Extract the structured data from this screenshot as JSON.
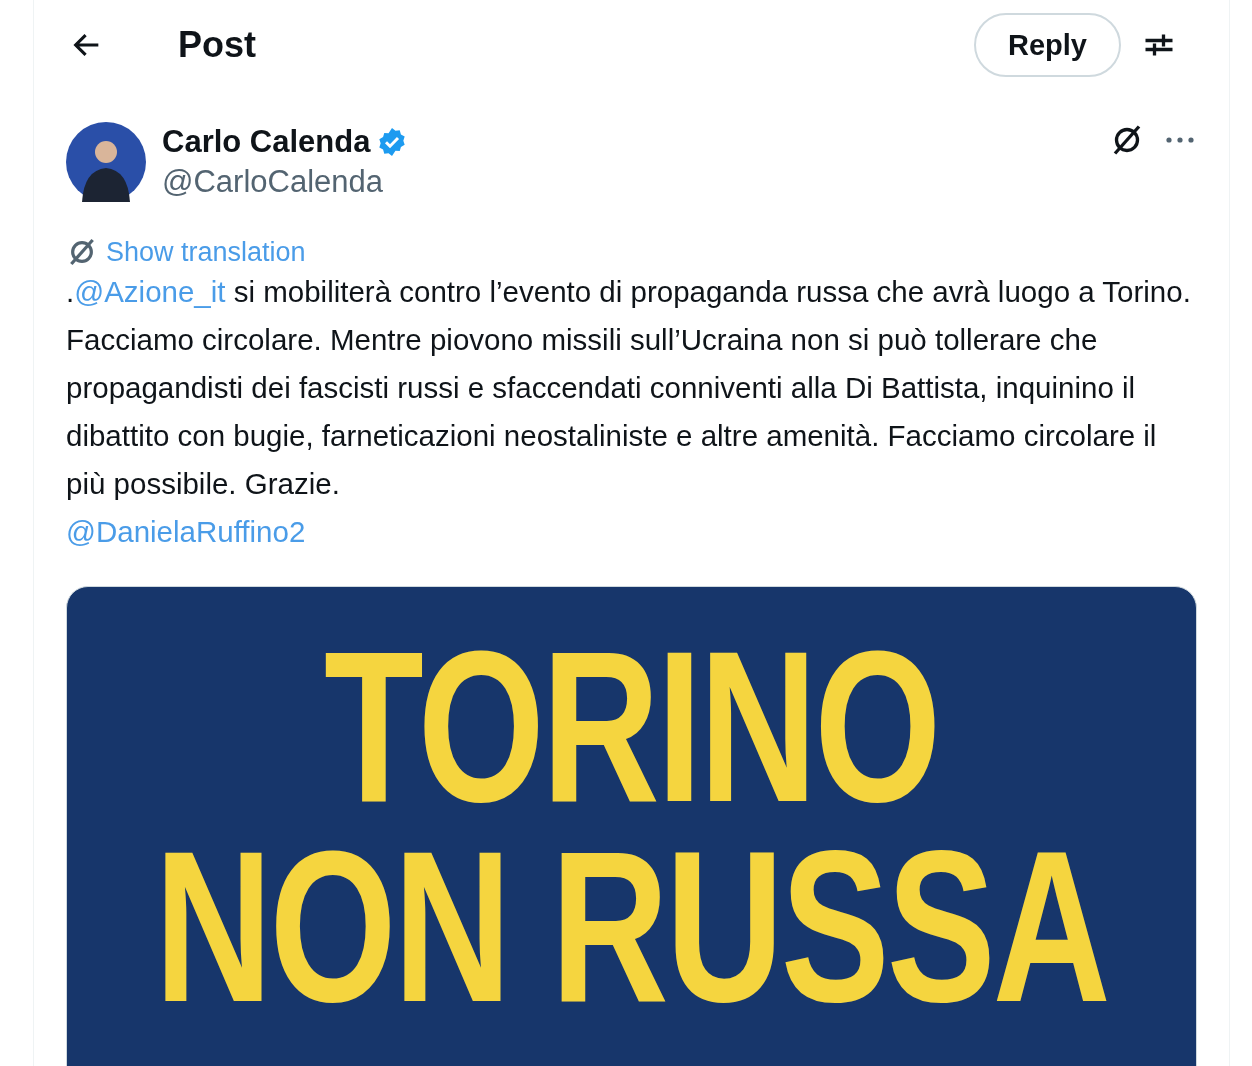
{
  "header": {
    "title": "Post",
    "reply_button": "Reply"
  },
  "author": {
    "name": "Carlo Calenda",
    "handle": "@CarloCalenda",
    "verified": true
  },
  "translation_link": "Show translation",
  "body": [
    [
      {
        "kind": "text",
        "text": "."
      },
      {
        "kind": "mention",
        "text": "@Azione_it"
      },
      {
        "kind": "text",
        "text": " si mobiliterà contro l’evento di propaganda russa che avrà luogo a Torino. Facciamo circolare. Mentre piovono missili sull’Ucraina non si può tollerare che propagandisti dei fascisti russi e sfaccendati conniventi alla Di Battista, inquinino il dibattito con bugie, farneticazioni neostaliniste e altre amenità. Facciamo circolare il più possibile. Grazie."
      },
      {
        "kind": "break"
      },
      {
        "kind": "mention",
        "text": "@DanielaRuffino2"
      }
    ]
  ],
  "media": {
    "lines": [
      "TORINO",
      "NON RUSSA"
    ]
  }
}
